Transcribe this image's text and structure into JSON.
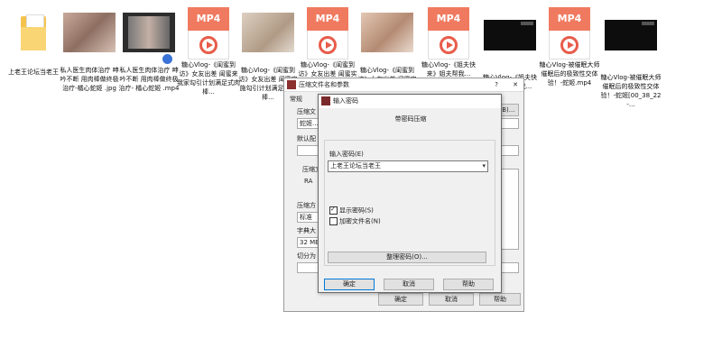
{
  "files": [
    {
      "kind": "folder",
      "name": "上老王论坛当老王"
    },
    {
      "kind": "photo",
      "name": "私人医生肉体治疗 呻吟不断 用肉棒做终极治疗-橘心蛇姬 .jpg",
      "color": "#b69a8a"
    },
    {
      "kind": "video",
      "name": "私人医生肉体治疗 呻吟不断 用肉棒做终极治疗- 橘心蛇姬 .mp4"
    },
    {
      "kind": "mp4",
      "name": "糖心Vlog-《闺蜜到访》女友出差 闺蜜来我家勾引计划满足式肉棒..."
    },
    {
      "kind": "photo",
      "name": "糖心Vlog-《闺蜜到访》女友出差 闺蜜实施勾引计划满足式肉棒...",
      "color": "#c7b6a4"
    },
    {
      "kind": "mp4",
      "name": "糖心Vlog-《闺蜜到访》女友出差 闺蜜实施勾引计划满足式..."
    },
    {
      "kind": "photo",
      "name": "糖心Vlog-《闺蜜到访》女友出差 闺蜜实施勾引..",
      "color": "#d2b4a0"
    },
    {
      "kind": "mp4",
      "name": "糖心Vlog-《姐夫快来》姐夫帮我..."
    },
    {
      "kind": "black",
      "name": "糖心Vlog-《姐夫快来》姐夫帮我..."
    },
    {
      "kind": "mp4",
      "name": "糖心Vlog-被催眠大师催眠后的极致性交体验！-蛇姬.mp4"
    },
    {
      "kind": "black",
      "name": "糖心Vlog-被催眠大师催眠后的极致性交体验！-蛇姬[00_38_22-..."
    }
  ],
  "mp4_label": "MP4",
  "bg_dialog": {
    "title": "压缩文件名和参数",
    "help": "?",
    "close": "✕",
    "tab": "常规",
    "label_name": "压缩文",
    "name_value": "蛇姬...",
    "browse_label": "浏览(B)...",
    "label_default": "默认配",
    "label_format": "压缩文",
    "format_option": "RA",
    "label_method": "压缩方",
    "method_value": "标准",
    "label_dict": "字典大",
    "dict_value": "32 MB",
    "label_split": "切分为",
    "ok": "确定",
    "cancel": "取消",
    "help_btn": "帮助"
  },
  "pw_dialog": {
    "title": "输入密码",
    "heading": "带密码压缩",
    "label": "输入密码(E)",
    "password": "上老王论坛当老王",
    "show_password": "显示密码(S)",
    "show_password_checked": true,
    "encrypt_names": "加密文件名(N)",
    "encrypt_names_checked": false,
    "organize": "整理密码(O)...",
    "ok": "确定",
    "cancel": "取消",
    "help": "帮助"
  }
}
